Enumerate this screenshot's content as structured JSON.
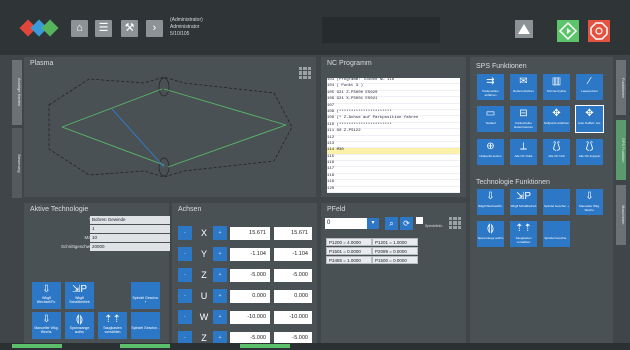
{
  "header": {
    "user_lines": [
      "(Administrator)",
      "Administrator",
      "5/10/105"
    ]
  },
  "side_tabs": {
    "left": [
      "Anzeige Kanten",
      "Steuerung"
    ],
    "right": [
      "Funktionen",
      "SPS Funktion",
      "Maschinen"
    ]
  },
  "plasma": {
    "title": "Plasma"
  },
  "nc": {
    "title": "NC Programm",
    "lines": [
      "103 (Programm: TD4000 NC 116",
      "104 ( Punkt 3 )",
      "105 G21 Z-PS000 ES020",
      "106 G21 X-PS001 ES021",
      "107",
      "108 (**********************",
      "109 (* Z-Achse auf Parkposition fahren",
      "110 (**********************",
      "111 G0 Z-PS122",
      "112",
      "113",
      "114 M30",
      "115",
      "116",
      "117",
      "118",
      "119",
      "120",
      "121",
      "122",
      "123"
    ]
  },
  "technologie": {
    "title": "Aktive Technologie",
    "rows": [
      {
        "label": "Technologie:",
        "value": "Bohren Gewinde"
      },
      {
        "label": "Datensatz:",
        "value": "1"
      },
      {
        "label": "Materialstärke:",
        "value": "10"
      },
      {
        "label": "Schnittgeschw.(n) Spindel:",
        "value": "20000"
      }
    ],
    "buttons": [
      {
        "glyph": "⇩",
        "label": "Wkgfl Wechsel/Fn."
      },
      {
        "glyph": "⇲P",
        "label": "Wkgfl Schaltbetrieb"
      },
      {
        "glyph": "",
        "label": "Spindel Geschw. +"
      },
      {
        "glyph": "⇩",
        "label": "Manueller Wkg. Wechs."
      },
      {
        "glyph": "⟬⟭",
        "label": "Spannzange auf/zu"
      },
      {
        "glyph": "⇡⇡",
        "label": "Saugkasten vorwählen"
      },
      {
        "glyph": "",
        "label": "Spindel Geschw. -"
      }
    ]
  },
  "achsen": {
    "title": "Achsen",
    "axes": [
      {
        "name": "X",
        "value": "15.671",
        "value2": "15.671"
      },
      {
        "name": "Y",
        "value": "-1.104",
        "value2": "-1.104"
      },
      {
        "name": "Z",
        "value": "-5.000",
        "value2": "-5.000"
      },
      {
        "name": "U",
        "value": "0.000",
        "value2": "0.000"
      },
      {
        "name": "W",
        "value": "-10.000",
        "value2": "-10.000"
      },
      {
        "name": "Z",
        "value": "-5.000",
        "value2": "-5.000"
      }
    ],
    "minus_label": "-",
    "plus_label": "+"
  },
  "pfeld": {
    "title": "PFeld",
    "input_value": "0",
    "checkbox_label": "Spindelinfo",
    "cells": [
      [
        "P1200 = 4.0000",
        "P1201 = 1.0000"
      ],
      [
        "P1501 = 0.0000",
        "P2089 = 0.0000"
      ],
      [
        "P3485 = 1.0000",
        "P1500 = 0.0000"
      ]
    ]
  },
  "sps": {
    "title": "SPS Funktionen",
    "buttons": [
      {
        "glyph": "⇉",
        "label": "Parkposition anfahren"
      },
      {
        "glyph": "✉",
        "label": "Referenzfahren"
      },
      {
        "glyph": "▥",
        "label": "Schmierzyklus"
      },
      {
        "glyph": "∕",
        "label": "Laserpointer"
      },
      {
        "glyph": "▭",
        "label": "Testlauf"
      },
      {
        "glyph": "⊟",
        "label": "Parkscheibe ändern/setzen"
      },
      {
        "glyph": "✥",
        "label": "Nullpunkt anfahren"
      },
      {
        "glyph": "✥",
        "label": "Auto Nullfeh. Am."
      },
      {
        "glyph": "⊕",
        "label": "Nullpunkt setzen"
      },
      {
        "glyph": "⟂",
        "label": "Alle NC Nulls"
      },
      {
        "glyph": "⟅⟆",
        "label": "Alle NC Null"
      },
      {
        "glyph": "⟅⟆",
        "label": "Alle NC koppeln"
      }
    ],
    "tech_title": "Technologie Funktionen",
    "tech_buttons": [
      {
        "glyph": "⇩",
        "label": "Wkgfl Wechsel/Fn."
      },
      {
        "glyph": "⇲P",
        "label": "Wkgfl Schaltbetrieb"
      },
      {
        "glyph": "",
        "label": "Spindel Geschw. +"
      },
      {
        "glyph": "⇩",
        "label": "Manueller Wkg. Wechs."
      },
      {
        "glyph": "⟬⟭",
        "label": "Spannzange auf/zu"
      },
      {
        "glyph": "⇡⇡",
        "label": "Saugkasten vorwählen"
      },
      {
        "glyph": "",
        "label": "Spindel Geschw. -"
      }
    ]
  }
}
